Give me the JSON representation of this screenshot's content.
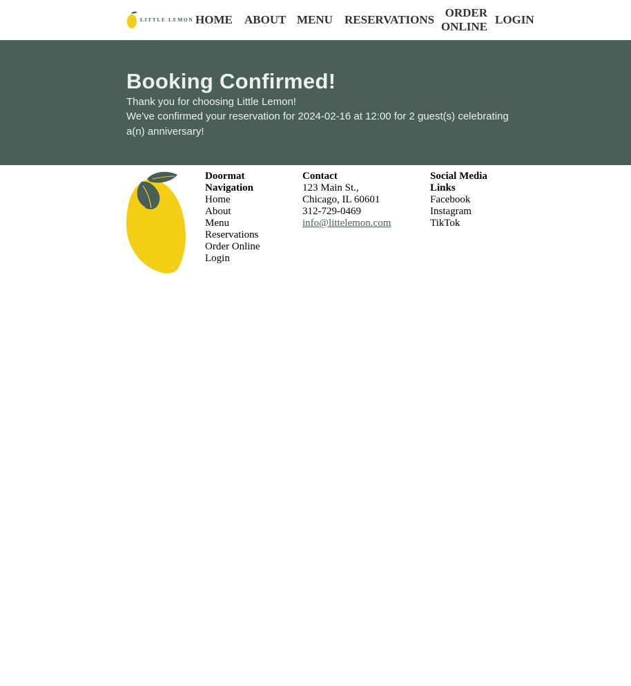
{
  "header": {
    "logo_text": "LITTLE LEMON",
    "nav": {
      "home": "HOME",
      "about": "ABOUT",
      "menu": "MENU",
      "reservations": "RESERVATIONS",
      "order_online": "ORDER ONLINE",
      "login": "LOGIN"
    }
  },
  "hero": {
    "title": "Booking Confirmed!",
    "thanks": "Thank you for choosing Little Lemon!",
    "details": "We've confirmed your reservation for 2024-02-16 at 12:00 for 2 guest(s) celebrating a(n) anniversary!"
  },
  "footer": {
    "doormat": {
      "heading": "Doormat Navigation",
      "links": [
        "Home",
        "About",
        "Menu",
        "Reservations",
        "Order Online",
        "Login"
      ]
    },
    "contact": {
      "heading": "Contact",
      "address1": "123 Main St.,",
      "address2": "Chicago, IL 60601",
      "phone": "312-729-0469",
      "email": "info@littelemon.com"
    },
    "social": {
      "heading": "Social Media Links",
      "links": [
        "Facebook",
        "Instagram",
        "TikTok"
      ]
    }
  },
  "colors": {
    "primary_green": "#495e57",
    "lemon_yellow": "#f4ce14",
    "hero_text": "#edefee"
  }
}
